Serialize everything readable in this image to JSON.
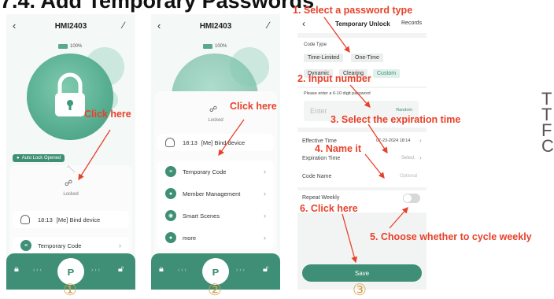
{
  "heading": "7.4. Add Temporary Passwords",
  "side_text": [
    "T",
    "T",
    "F",
    "C"
  ],
  "phone1": {
    "title": "HMI2403",
    "battery": "100%",
    "auto_lock_badge": "Auto Lock Opened",
    "locked_label": "Locked",
    "log_time": "18:13",
    "log_text": "[Me]  Bind device",
    "temporary_code": "Temporary Code",
    "callout": "Click here",
    "step_number": "①"
  },
  "phone2": {
    "title": "HMI2403",
    "battery": "100%",
    "locked_label": "Locked",
    "log_time": "18:13",
    "log_text": "[Me]  Bind device",
    "menu": [
      "Temporary Code",
      "Member Management",
      "Smart Scenes",
      "more"
    ],
    "callout": "Click here",
    "step_number": "②"
  },
  "phone3": {
    "title": "Temporary Unlock",
    "records": "Records",
    "code_type_label": "Code Type",
    "type_options": [
      "Time-Limited",
      "One-Time"
    ],
    "sub_options": [
      "Dynamic",
      "Clearing",
      "Custom"
    ],
    "password_hint": "Please enter a 6-10 digit password",
    "password_placeholder": "Enter",
    "random_label": "Random",
    "effective_time_label": "Effective Time",
    "effective_time_value": "07-23-2024 18:14",
    "expiration_time_label": "Expiration Time",
    "expiration_time_value": "Select",
    "code_name_label": "Code Name",
    "code_name_placeholder": "Optional",
    "repeat_weekly_label": "Repeat Weekly",
    "save_label": "Save",
    "step_number": "③"
  },
  "annotations": {
    "step1": "1. Select a password type",
    "step2": "2. Input number",
    "step3": "3. Select the expiration time",
    "step4": "4. Name it",
    "step5": "5. Choose whether to cycle weekly",
    "step6": "6. Click here"
  },
  "colors": {
    "accent": "#3e8f75",
    "annotation": "#e8412a",
    "step_number": "#d8a04a"
  }
}
